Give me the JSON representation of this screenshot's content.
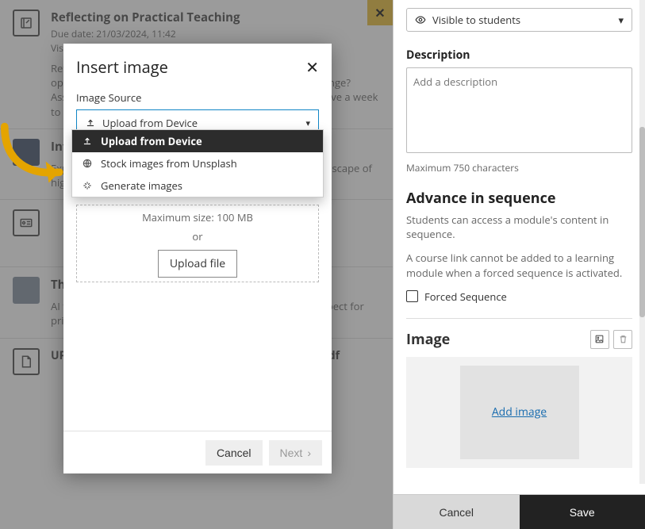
{
  "main": {
    "close_glyph": "✕",
    "items": [
      {
        "title": "Reflecting on Practical Teaching",
        "due": "Due date: 21/03/2024, 11:42",
        "visibility": "Visible to students",
        "body": "Reflect on what you learned during your practical teaching opportunities. How did you improve? What would you change? Assess the effectiveness of your teaching methods. You have a week to do this."
      },
      {
        "title": "Introduction",
        "body": "Explore the context of this module within the broader landscape of higher education, teaching and learning."
      },
      {
        "title": "The use of ChatGPT",
        "body": "AI tools like ChatGPT enhance learning while fostering respect for privacy and adopting effective strategies."
      },
      {
        "title": "UP Guide for ChatGTP for Teaching and Learning.pdf"
      }
    ]
  },
  "right_panel": {
    "visibility_label": "Visible to students",
    "description_label": "Description",
    "description_placeholder": "Add a description",
    "description_help": "Maximum 750 characters",
    "seq_heading": "Advance in sequence",
    "seq_text1": "Students can access a module's content in sequence.",
    "seq_text2": "A course link cannot be added to a learning module when a forced sequence is activated.",
    "forced_seq_label": "Forced Sequence",
    "image_heading": "Image",
    "add_image_label": "Add image",
    "cancel": "Cancel",
    "save": "Save"
  },
  "modal": {
    "title": "Insert image",
    "source_label": "Image Source",
    "combo_value": "Upload from Device",
    "dd_opts": [
      "Upload from Device",
      "Stock images from Unsplash",
      "Generate images"
    ],
    "max_size": "Maximum size: 100 MB",
    "or": "or",
    "upload_file": "Upload file",
    "cancel": "Cancel",
    "next": "Next"
  }
}
